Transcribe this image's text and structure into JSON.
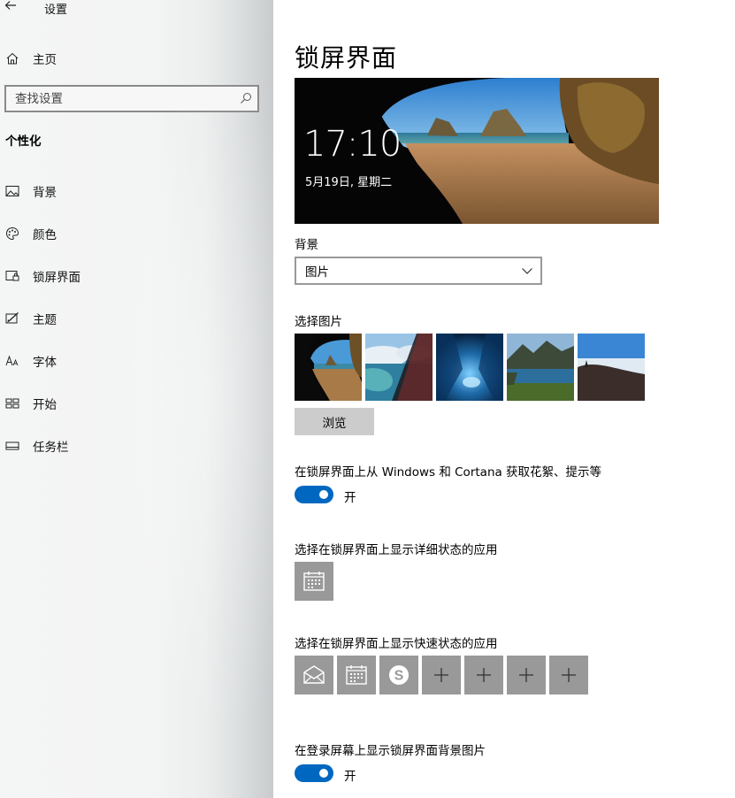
{
  "app": {
    "title": "设置"
  },
  "sidebar": {
    "home_label": "主页",
    "search": {
      "placeholder": "查找设置"
    },
    "section_title": "个性化",
    "items": [
      {
        "label": "背景",
        "icon": "image-icon"
      },
      {
        "label": "颜色",
        "icon": "palette-icon"
      },
      {
        "label": "锁屏界面",
        "icon": "lockscreen-icon"
      },
      {
        "label": "主题",
        "icon": "theme-icon"
      },
      {
        "label": "字体",
        "icon": "font-icon"
      },
      {
        "label": "开始",
        "icon": "start-icon"
      },
      {
        "label": "任务栏",
        "icon": "taskbar-icon"
      }
    ]
  },
  "main": {
    "title": "锁屏界面",
    "preview": {
      "time": "17:10",
      "date": "5月19日, 星期二"
    },
    "background_label": "背景",
    "background_value": "图片",
    "choose_picture_label": "选择图片",
    "browse_label": "浏览",
    "fun_facts": {
      "label": "在锁屏界面上从 Windows 和 Cortana 获取花絮、提示等",
      "state": "开"
    },
    "detailed_status_label": "选择在锁屏界面上显示详细状态的应用",
    "quick_status_label": "选择在锁屏界面上显示快速状态的应用",
    "signin_background": {
      "label": "在登录屏幕上显示锁屏界面背景图片",
      "state": "开"
    }
  },
  "colors": {
    "accent": "#0067c0",
    "tile": "#999999",
    "button": "#cccccc"
  }
}
